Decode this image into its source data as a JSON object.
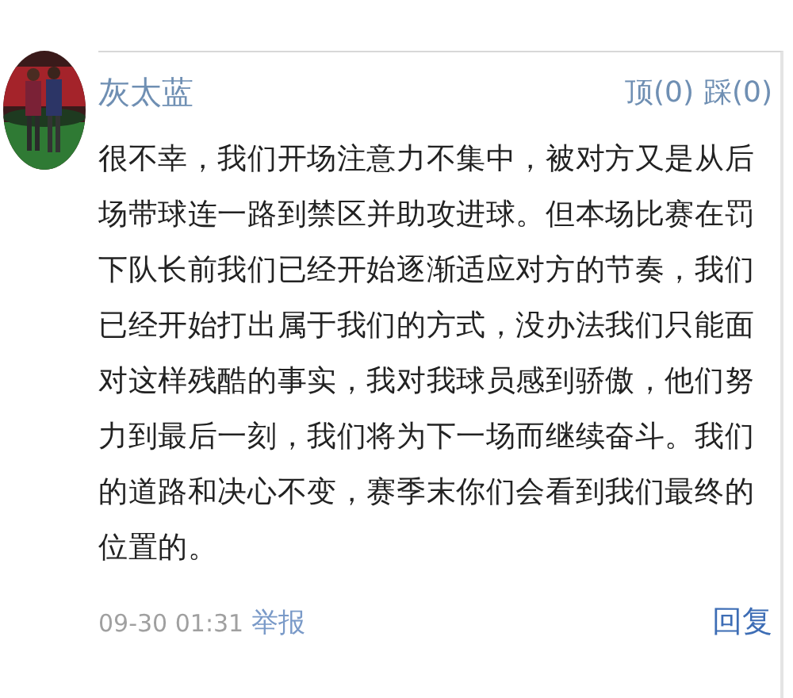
{
  "comment": {
    "username": "灰太蓝",
    "votes": [
      {
        "label": "顶(0)"
      },
      {
        "label": "踩(0)"
      }
    ],
    "body": "很不幸，我们开场注意力不集中，被对方又是从后场带球连一路到禁区并助攻进球。但本场比赛在罚下队长前我们已经开始逐渐适应对方的节奏，我们已经开始打出属于我们的方式，没办法我们只能面对这样残酷的事实，我对我球员感到骄傲，他们努力到最后一刻，我们将为下一场而继续奋斗。我们的道路和决心不变，赛季末你们会看到我们最终的位置的。",
    "time": "09-30 01:31",
    "report": "举报",
    "reply": "回复"
  }
}
